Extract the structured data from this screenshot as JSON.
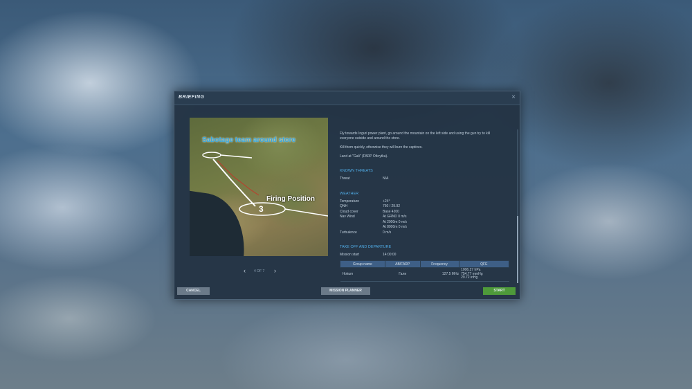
{
  "window": {
    "title": "BRIEFING",
    "close_glyph": "×"
  },
  "map": {
    "label_team": "Sabotage team around store",
    "label_firing": "Firing Position",
    "waypoint_number": "3"
  },
  "pager": {
    "prev": "‹",
    "count": "4 OF 7",
    "next": "›"
  },
  "description": [
    "Fly towards Inguri power plant, go around the mountain on the left side and using the gun try to kill everyone outside and around the store.",
    "Kill them quickly, otherwise they will burn the captives.",
    "Land at \"Gali\" (FARP Otkrytka)."
  ],
  "threats": {
    "heading": "KNOWN THREATS",
    "rows": [
      {
        "key": "Threat",
        "value": "N/A"
      }
    ]
  },
  "weather": {
    "heading": "WEATHER",
    "rows": [
      {
        "key": "Temperature",
        "value": "+24°"
      },
      {
        "key": "QNH",
        "value": "760 / 29.92"
      },
      {
        "key": "Cloud cover",
        "value": "Base 4200"
      },
      {
        "key": "Nav Wind",
        "value": "At GRND 0 m/s"
      },
      {
        "key": "",
        "value": "At 2000m 0 m/s"
      },
      {
        "key": "",
        "value": "At 8000m 0 m/s"
      },
      {
        "key": "Turbulence",
        "value": "0 m/s"
      }
    ]
  },
  "takeoff": {
    "heading": "TAKE OFF AND DEPARTURE",
    "mission_start_label": "Mission start",
    "mission_start_value": "14:00:00",
    "columns": [
      "Group name",
      "AB/FARP",
      "Frequency",
      "QFE"
    ],
    "rows": [
      {
        "group": "Hokum",
        "farp": "Гали",
        "freq": "127.5 MHz",
        "qfe": [
          "1006.27 hPa",
          "754.77 mmHg",
          "29.72 inHg"
        ]
      }
    ]
  },
  "buttons": {
    "cancel": "CANCEL",
    "planner": "MISSION PLANNER",
    "start": "START"
  },
  "colors": {
    "accent": "#4fa9e2",
    "start": "#4e9a3a",
    "button": "#6b7a89",
    "table_header": "#3e5f86"
  }
}
